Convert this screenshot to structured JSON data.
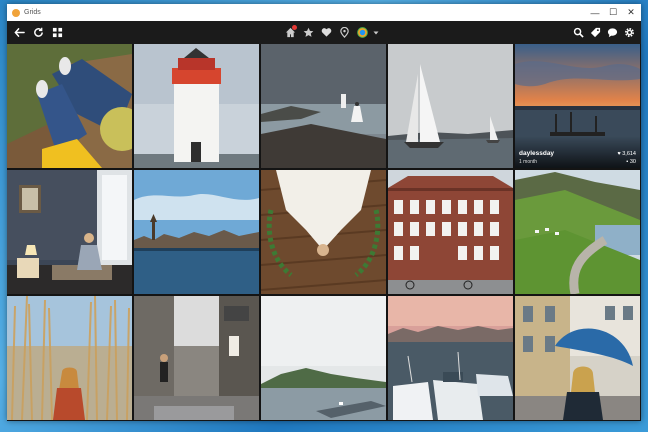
{
  "window": {
    "title": "Grids",
    "controls": [
      "—",
      "☐",
      "✕"
    ]
  },
  "toolbar": {
    "left_icons": [
      "back-arrow-icon",
      "refresh-icon",
      "grid-icon"
    ],
    "center_icons": [
      "home-icon",
      "star-icon",
      "heart-icon",
      "location-icon",
      "avatar"
    ],
    "right_icons": [
      "search-icon",
      "tag-icon",
      "comment-icon",
      "gear-icon"
    ],
    "accent": "#e53935"
  },
  "photos": [
    {
      "subject": "feet-on-dock"
    },
    {
      "subject": "lighthouse"
    },
    {
      "subject": "coast-bride"
    },
    {
      "subject": "sailboats"
    },
    {
      "subject": "harbor-sunset",
      "caption": {
        "user": "daylessday",
        "time": "1 month",
        "likes": "♥ 3,614",
        "comments": "▪ 30"
      }
    },
    {
      "subject": "hotel-room-woman"
    },
    {
      "subject": "city-waterfront"
    },
    {
      "subject": "bride-on-wood"
    },
    {
      "subject": "brick-building"
    },
    {
      "subject": "green-valley-road"
    },
    {
      "subject": "girl-in-reeds"
    },
    {
      "subject": "street-archway"
    },
    {
      "subject": "foggy-island"
    },
    {
      "subject": "boats-harbor"
    },
    {
      "subject": "woman-blue-umbrella"
    }
  ]
}
